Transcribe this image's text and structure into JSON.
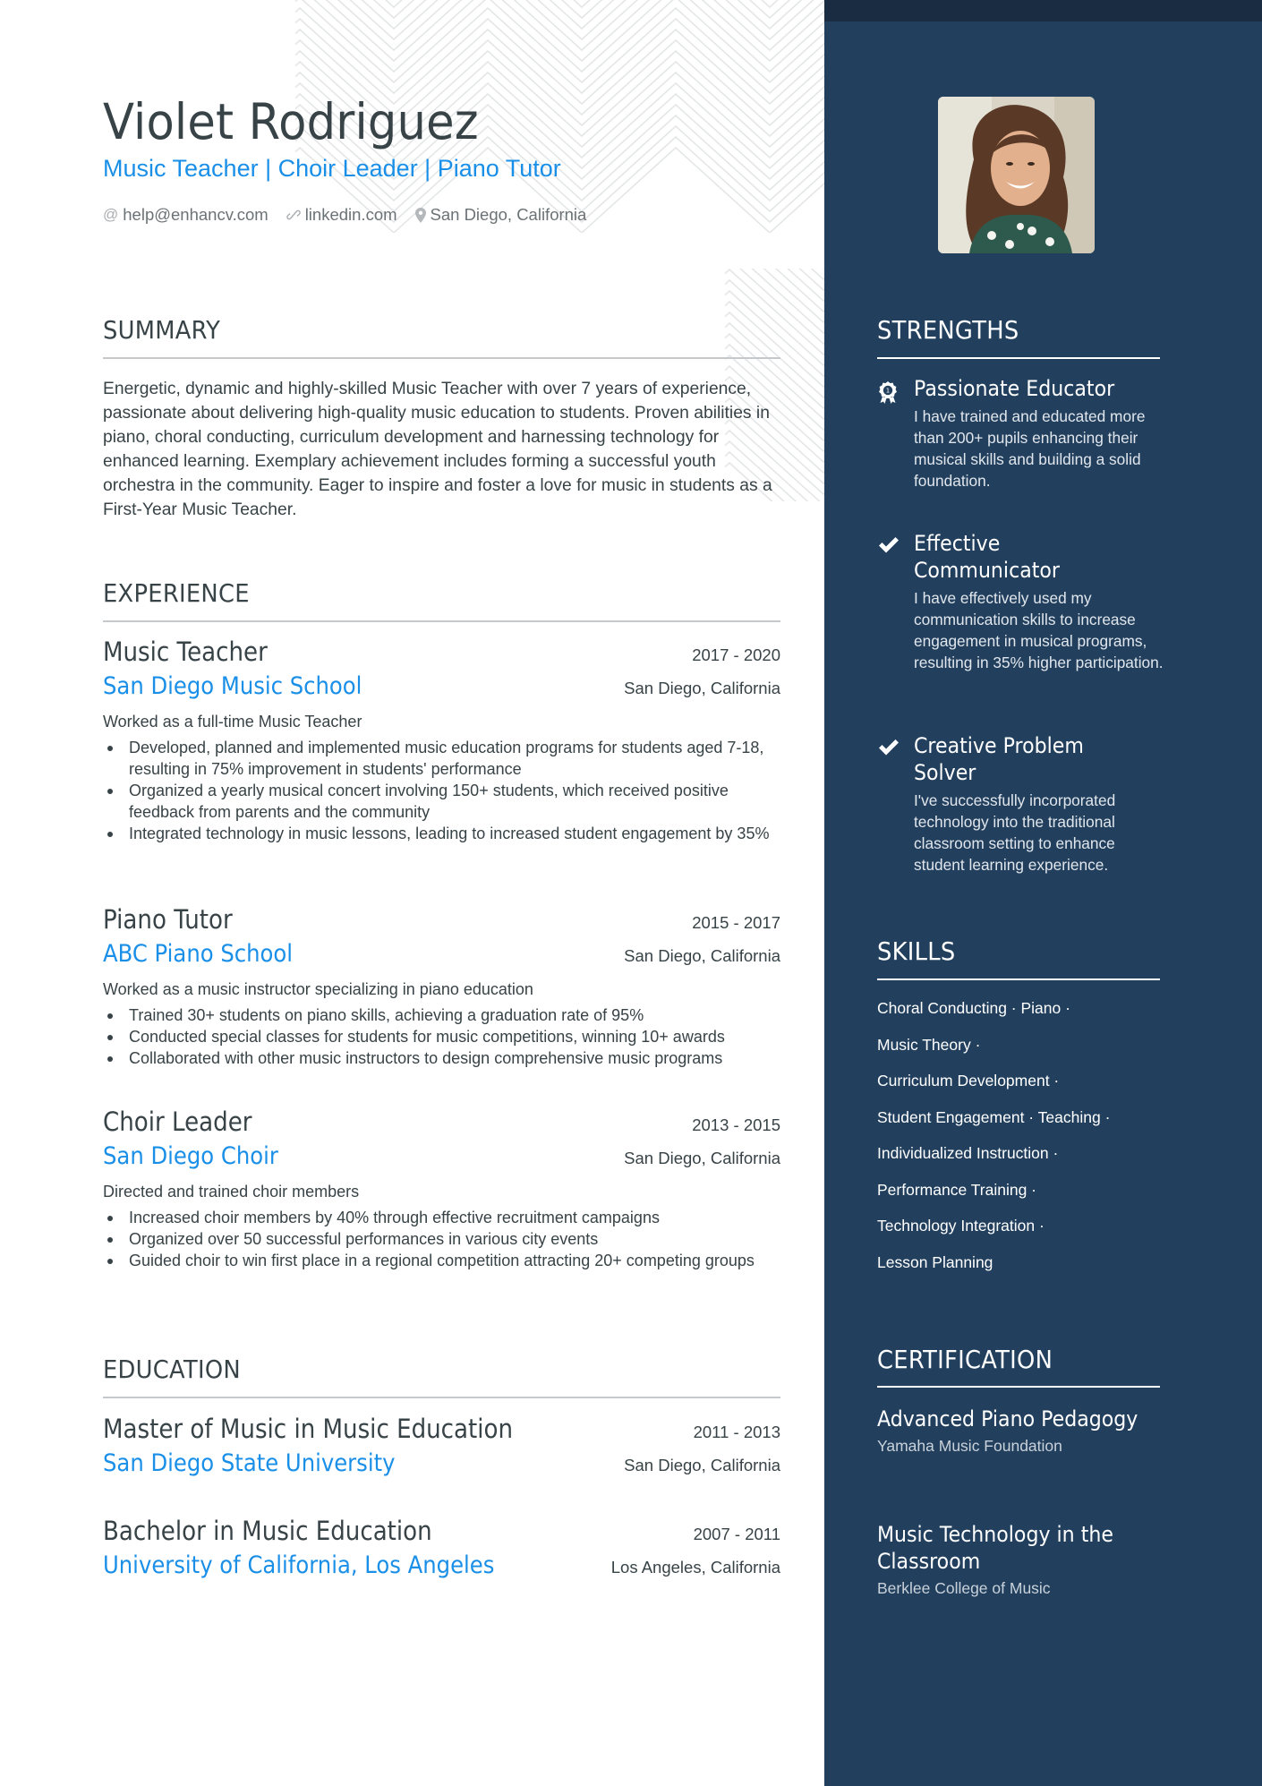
{
  "colors": {
    "accent": "#1a8fe8",
    "text": "#384347",
    "sidebar_bg": "#22405e",
    "sidebar_topband": "#1a2c42"
  },
  "header": {
    "name": "Violet Rodriguez",
    "title": "Music Teacher | Choir Leader | Piano Tutor",
    "contacts": [
      {
        "icon": "at-icon",
        "label": "help@enhancv.com"
      },
      {
        "icon": "link-icon",
        "label": "linkedin.com"
      },
      {
        "icon": "location-pin-icon",
        "label": "San Diego, California"
      }
    ]
  },
  "summary": {
    "heading": "SUMMARY",
    "text": "Energetic, dynamic and highly-skilled Music Teacher with over 7 years of experience, passionate about delivering high-quality music education to students. Proven abilities in piano, choral conducting, curriculum development and harnessing technology for enhanced learning. Exemplary achievement includes forming a successful youth orchestra in the community. Eager to inspire and foster a love for music in students as a First-Year Music Teacher."
  },
  "experience": {
    "heading": "EXPERIENCE",
    "items": [
      {
        "role": "Music Teacher",
        "dates": "2017 - 2020",
        "company": "San Diego Music School",
        "location": "San Diego, California",
        "description": "Worked as a full-time Music Teacher",
        "bullets": [
          "Developed, planned and implemented music education programs for students aged 7-18, resulting in 75% improvement in students' performance",
          "Organized a yearly musical concert involving 150+ students, which received positive feedback from parents and the community",
          "Integrated technology in music lessons, leading to increased student engagement by 35%"
        ]
      },
      {
        "role": "Piano Tutor",
        "dates": "2015 - 2017",
        "company": "ABC Piano School",
        "location": "San Diego, California",
        "description": "Worked as a music instructor specializing in piano education",
        "bullets": [
          "Trained 30+ students on piano skills, achieving a graduation rate of 95%",
          "Conducted special classes for students for music competitions, winning 10+ awards",
          "Collaborated with other music instructors to design comprehensive music programs"
        ]
      },
      {
        "role": "Choir Leader",
        "dates": "2013 - 2015",
        "company": "San Diego Choir",
        "location": "San Diego, California",
        "description": "Directed and trained choir members",
        "bullets": [
          "Increased choir members by 40% through effective recruitment campaigns",
          "Organized over 50 successful performances in various city events",
          "Guided choir to win first place in a regional competition attracting 20+ competing groups"
        ]
      }
    ]
  },
  "education": {
    "heading": "EDUCATION",
    "items": [
      {
        "degree": "Master of Music in Music Education",
        "dates": "2011 - 2013",
        "school": "San Diego State University",
        "location": "San Diego, California"
      },
      {
        "degree": "Bachelor in Music Education",
        "dates": "2007 - 2011",
        "school": "University of California, Los Angeles",
        "location": "Los Angeles, California"
      }
    ]
  },
  "sidebar": {
    "photo_alt": "Profile photo of Violet Rodriguez",
    "strengths": {
      "heading": "STRENGTHS",
      "items": [
        {
          "icon": "award-ribbon-icon",
          "title": "Passionate Educator",
          "description": "I have trained and educated more than 200+ pupils enhancing their musical skills and building a solid foundation."
        },
        {
          "icon": "checkmark-icon",
          "title": "Effective Communicator",
          "description": "I have effectively used my communication skills to increase engagement in musical programs, resulting in 35% higher participation."
        },
        {
          "icon": "checkmark-icon",
          "title": "Creative Problem Solver",
          "description": "I've successfully incorporated technology into the traditional classroom setting to enhance student learning experience."
        }
      ]
    },
    "skills": {
      "heading": "SKILLS",
      "lines": [
        "Choral Conducting · Piano ·",
        "Music Theory ·",
        "Curriculum Development ·",
        "Student Engagement · Teaching ·",
        "Individualized Instruction ·",
        "Performance Training ·",
        "Technology Integration ·",
        "Lesson Planning"
      ]
    },
    "certification": {
      "heading": "CERTIFICATION",
      "items": [
        {
          "title": "Advanced Piano Pedagogy",
          "organization": "Yamaha Music Foundation"
        },
        {
          "title": "Music Technology in the Classroom",
          "organization": "Berklee College of Music"
        }
      ]
    }
  }
}
